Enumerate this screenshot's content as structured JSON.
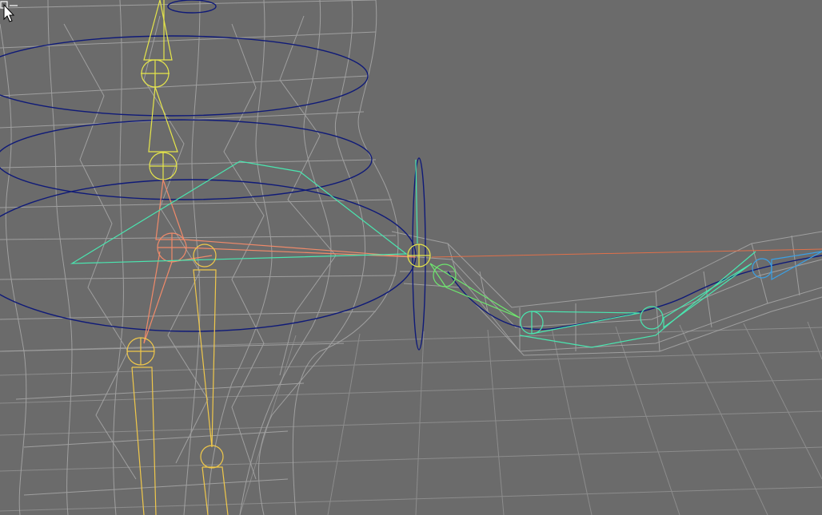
{
  "viewport": {
    "background": "#6b6b6b",
    "grid_color": "#8c8c8c",
    "mesh_color": "#a6a6a6"
  },
  "rig": {
    "colors": {
      "control_circle": "#0f1a78",
      "spine_bones": "#e6e64a",
      "hip_bones": "#f08a6a",
      "leg_bones": "#f0c84a",
      "arm_bones": "#4ae6b0",
      "hand_bones": "#3aa0e6",
      "ik_line": "#e0704a"
    }
  },
  "cursor": {
    "icon": "select-arrow-with-box-icon"
  }
}
